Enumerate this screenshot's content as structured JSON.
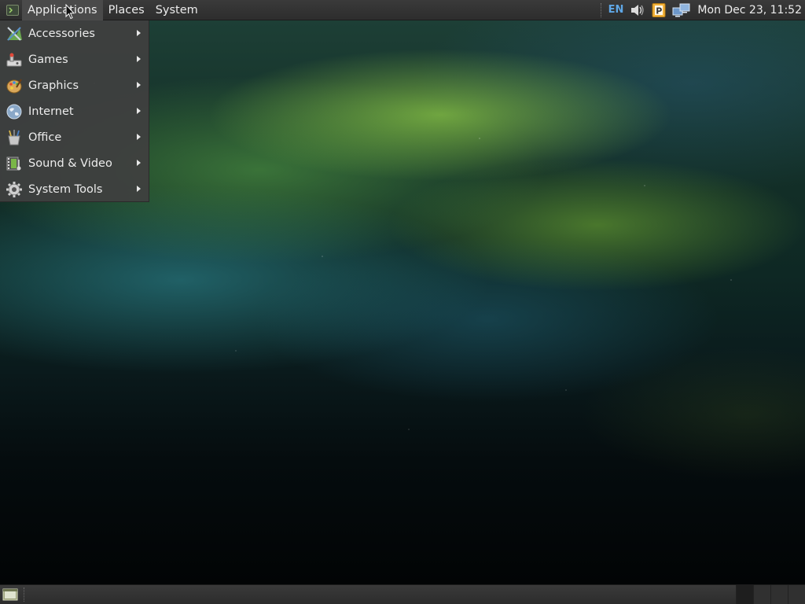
{
  "top_panel": {
    "menus": {
      "applications": "Applications",
      "places": "Places",
      "system": "System"
    },
    "tray": {
      "keyboard_layout": "EN",
      "volume_icon": "speaker-icon",
      "clipboard_icon": "clipboard-icon",
      "network_icon": "network-icon",
      "clock": "Mon Dec 23, 11:52"
    }
  },
  "applications_menu": {
    "items": [
      {
        "label": "Accessories",
        "icon": "accessories-icon"
      },
      {
        "label": "Games",
        "icon": "games-icon"
      },
      {
        "label": "Graphics",
        "icon": "graphics-icon"
      },
      {
        "label": "Internet",
        "icon": "internet-icon"
      },
      {
        "label": "Office",
        "icon": "office-icon"
      },
      {
        "label": "Sound & Video",
        "icon": "sound-video-icon"
      },
      {
        "label": "System Tools",
        "icon": "system-tools-icon"
      }
    ]
  },
  "bottom_panel": {
    "workspace_count": 4,
    "active_workspace": 1
  },
  "colors": {
    "panel": "#2d2d2d",
    "menu_bg": "#404040",
    "keyboard_layout": "#5fa7e6",
    "text": "#ececec"
  }
}
